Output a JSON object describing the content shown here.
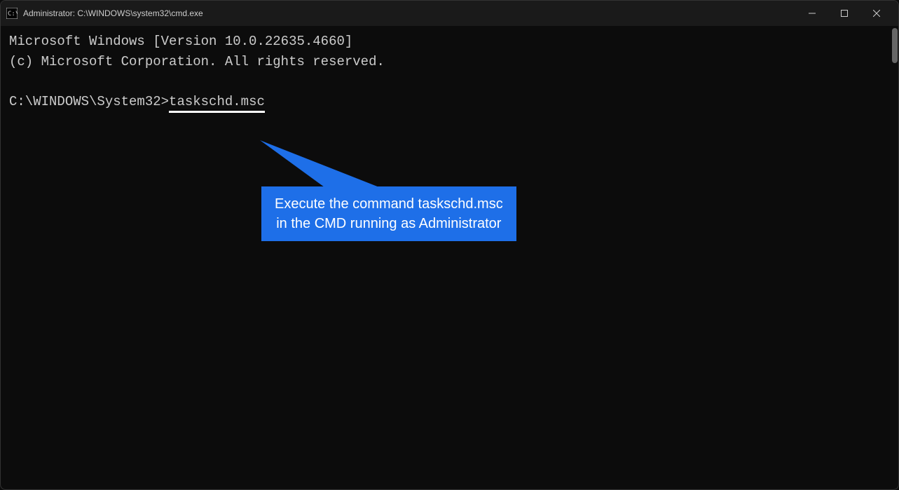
{
  "window": {
    "title": "Administrator: C:\\WINDOWS\\system32\\cmd.exe"
  },
  "terminal": {
    "line1": "Microsoft Windows [Version 10.0.22635.4660]",
    "line2": "(c) Microsoft Corporation. All rights reserved.",
    "prompt": "C:\\WINDOWS\\System32>",
    "command": "taskschd.msc"
  },
  "callout": {
    "line1": "Execute the command taskschd.msc",
    "line2": "in the CMD running as Administrator"
  }
}
